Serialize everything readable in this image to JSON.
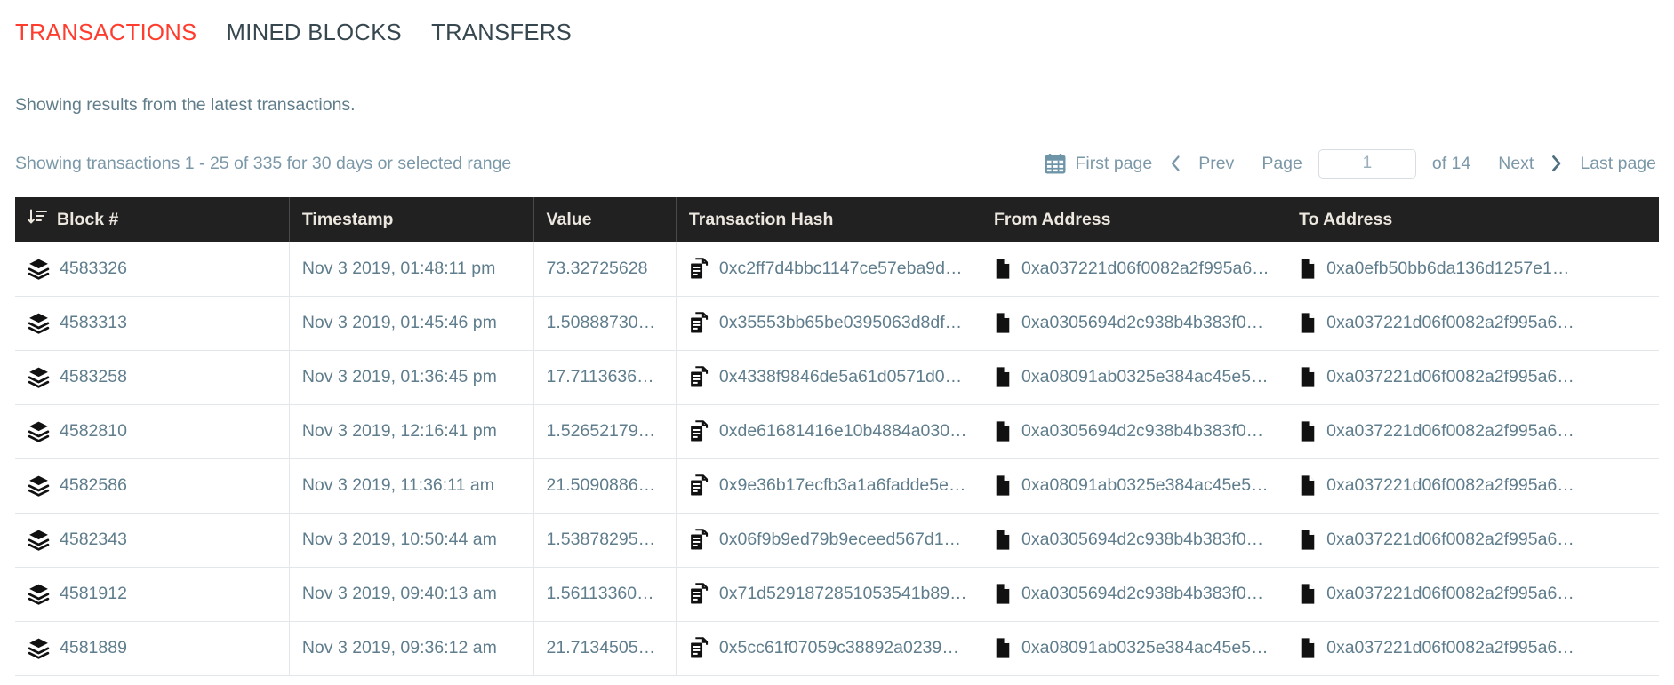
{
  "tabs": [
    {
      "label": "TRANSACTIONS",
      "active": true
    },
    {
      "label": "MINED BLOCKS",
      "active": false
    },
    {
      "label": "TRANSFERS",
      "active": false
    }
  ],
  "intro": "Showing results from the latest transactions.",
  "results_summary": "Showing transactions 1 - 25 of 335 for 30 days or selected range",
  "pager": {
    "calendar_icon": "calendar-icon",
    "first_page": "First page",
    "prev_icon": "chevron-left-icon",
    "prev": "Prev",
    "page_label": "Page",
    "page_value": "1",
    "page_placeholder": "1",
    "of_total": "of 14",
    "next": "Next",
    "next_icon": "chevron-right-icon",
    "last_page": "Last page"
  },
  "table": {
    "sort_icon": "sort-descending-icon",
    "block_icon": "layers-icon",
    "hash_icon": "copy-document-icon",
    "address_icon": "document-icon",
    "columns": [
      "Block #",
      "Timestamp",
      "Value",
      "Transaction Hash",
      "From Address",
      "To Address"
    ],
    "rows": [
      {
        "block": "4583326",
        "timestamp": "Nov 3 2019, 01:48:11 pm",
        "value": "73.32725628",
        "hash": "0xc2ff7d4bbc1147ce57eba9d…",
        "from": "0xa037221d06f0082a2f995a6…",
        "to": "0xa0efb50bb6da136d1257e1…"
      },
      {
        "block": "4583313",
        "timestamp": "Nov 3 2019, 01:45:46 pm",
        "value": "1.508887300…",
        "hash": "0x35553bb65be0395063d8df…",
        "from": "0xa0305694d2c938b4b383f0…",
        "to": "0xa037221d06f0082a2f995a6…"
      },
      {
        "block": "4583258",
        "timestamp": "Nov 3 2019, 01:36:45 pm",
        "value": "17.71136360…",
        "hash": "0x4338f9846de5a61d0571d0…",
        "from": "0xa08091ab0325e384ac45e5…",
        "to": "0xa037221d06f0082a2f995a6…"
      },
      {
        "block": "4582810",
        "timestamp": "Nov 3 2019, 12:16:41 pm",
        "value": "1.526521796…",
        "hash": "0xde61681416e10b4884a030…",
        "from": "0xa0305694d2c938b4b383f0…",
        "to": "0xa037221d06f0082a2f995a6…"
      },
      {
        "block": "4582586",
        "timestamp": "Nov 3 2019, 11:36:11 am",
        "value": "21.50908869…",
        "hash": "0x9e36b17ecfb3a1a6fadde5e…",
        "from": "0xa08091ab0325e384ac45e5…",
        "to": "0xa037221d06f0082a2f995a6…"
      },
      {
        "block": "4582343",
        "timestamp": "Nov 3 2019, 10:50:44 am",
        "value": "1.538782953…",
        "hash": "0x06f9b9ed79b9eceed567d1…",
        "from": "0xa0305694d2c938b4b383f0…",
        "to": "0xa037221d06f0082a2f995a6…"
      },
      {
        "block": "4581912",
        "timestamp": "Nov 3 2019, 09:40:13 am",
        "value": "1.561133600…",
        "hash": "0x71d5291872851053541b89…",
        "from": "0xa0305694d2c938b4b383f0…",
        "to": "0xa037221d06f0082a2f995a6…"
      },
      {
        "block": "4581889",
        "timestamp": "Nov 3 2019, 09:36:12 am",
        "value": "21.71345057…",
        "hash": "0x5cc61f07059c38892a0239…",
        "from": "0xa08091ab0325e384ac45e5…",
        "to": "0xa037221d06f0082a2f995a6…"
      }
    ]
  },
  "colors": {
    "active_tab": "#ff3d2e",
    "tab": "#37474f",
    "muted_text": "#7b98a8",
    "header_bg": "#212121",
    "header_text": "#ece7df",
    "link_text": "#5f7d8c",
    "icon_blue": "#6e94a8"
  }
}
